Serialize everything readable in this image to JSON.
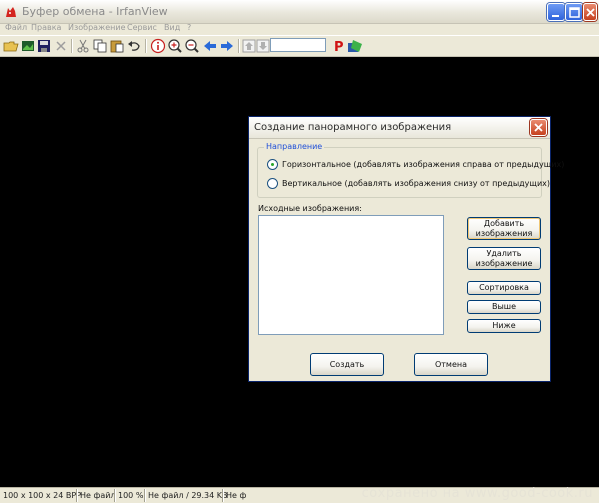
{
  "window": {
    "title": "Буфер обмена - IrfanView",
    "app_icon": "irfanview-cat-icon",
    "controls": [
      "minimize-icon",
      "maximize-icon",
      "close-icon"
    ]
  },
  "menubar": {
    "items": [
      "Файл",
      "Правка",
      "Изображение",
      "Сервис",
      "Вид",
      "?"
    ]
  },
  "toolbar": {
    "icons": [
      "open-folder-icon",
      "slideshow-icon",
      "save-icon",
      "delete-icon",
      "cut-icon",
      "copy-icon",
      "paste-icon",
      "undo-icon",
      "info-icon",
      "zoom-in-icon",
      "zoom-out-icon",
      "previous-arrow-icon",
      "next-arrow-icon",
      "up-icon",
      "down-icon",
      "page-input",
      "paint-icon",
      "options-icon"
    ],
    "page_input_value": ""
  },
  "dialog": {
    "title": "Создание панорамного изображения",
    "group_label": "Направление",
    "radio_horizontal": "Горизонтальное (добавлять изображения справа от предыдущих)",
    "radio_vertical": "Вертикальное (добавлять изображения снизу от предыдущих)",
    "selected_direction": "horizontal",
    "source_label": "Исходные изображения:",
    "buttons": {
      "add": "Добавить изображения",
      "remove": "Удалить изображение",
      "sort": "Сортировка",
      "up": "Выше",
      "down": "Ниже",
      "create": "Создать",
      "cancel": "Отмена"
    }
  },
  "statusbar": {
    "dims": "100 x 100 x 24 BPP",
    "file1": "Не файл",
    "zoom": "100 %",
    "filesize": "Не файл / 29.34 KB",
    "file2": "Не ф"
  },
  "watermark": "сохранено на www.good-cook.ru",
  "colors": {
    "canvas": "#000000",
    "window_bg": "#ece9d8",
    "group_label": "#1f4fd8",
    "accent_red": "#c6411f"
  }
}
